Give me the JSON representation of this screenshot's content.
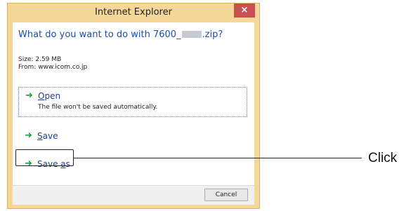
{
  "window": {
    "title": "Internet Explorer",
    "close_glyph": "×"
  },
  "question": {
    "prefix": "What do you want to do with 7600_",
    "suffix": ".zip?"
  },
  "file": {
    "size": "Size: 2.59 MB",
    "from": "From: www.icom.co.jp"
  },
  "options": {
    "open": {
      "label_ul": "O",
      "label_rest": "pen",
      "description": "The file won't be saved automatically."
    },
    "save": {
      "label_ul": "S",
      "label_rest": "ave"
    },
    "save_as": {
      "label_pre": "Save ",
      "label_ul": "a",
      "label_rest": "s"
    }
  },
  "footer": {
    "cancel_label": "Cancel"
  },
  "annotation": {
    "text": "Click"
  },
  "icons": {
    "option_arrow": "green-right-arrow-icon"
  },
  "colors": {
    "frame": "#f6d79a",
    "close": "#c75050",
    "link_blue": "#1f4fa0",
    "arrow_green": "#18a33a"
  }
}
